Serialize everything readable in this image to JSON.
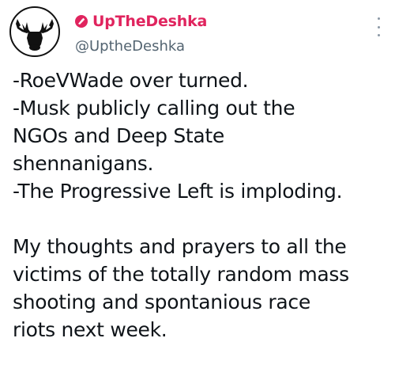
{
  "tweet": {
    "display_name": "UpTheDeshka",
    "handle": "@UptheDeshka",
    "avatar_icon": "moose-avatar-icon",
    "badge_icon": "pink-badge-icon",
    "more_icon": "more-vertical-icon",
    "accent_color": "#e0245e",
    "lines_part1": [
      "-RoeVWade over turned.",
      "-Musk publicly calling out the",
      "NGOs and Deep State",
      "shennanigans.",
      "-The Progressive Left is imploding."
    ],
    "lines_part2": [
      "My thoughts and prayers to all the",
      "victims of the totally random mass",
      "shooting and spontanious race",
      "riots next week."
    ]
  }
}
